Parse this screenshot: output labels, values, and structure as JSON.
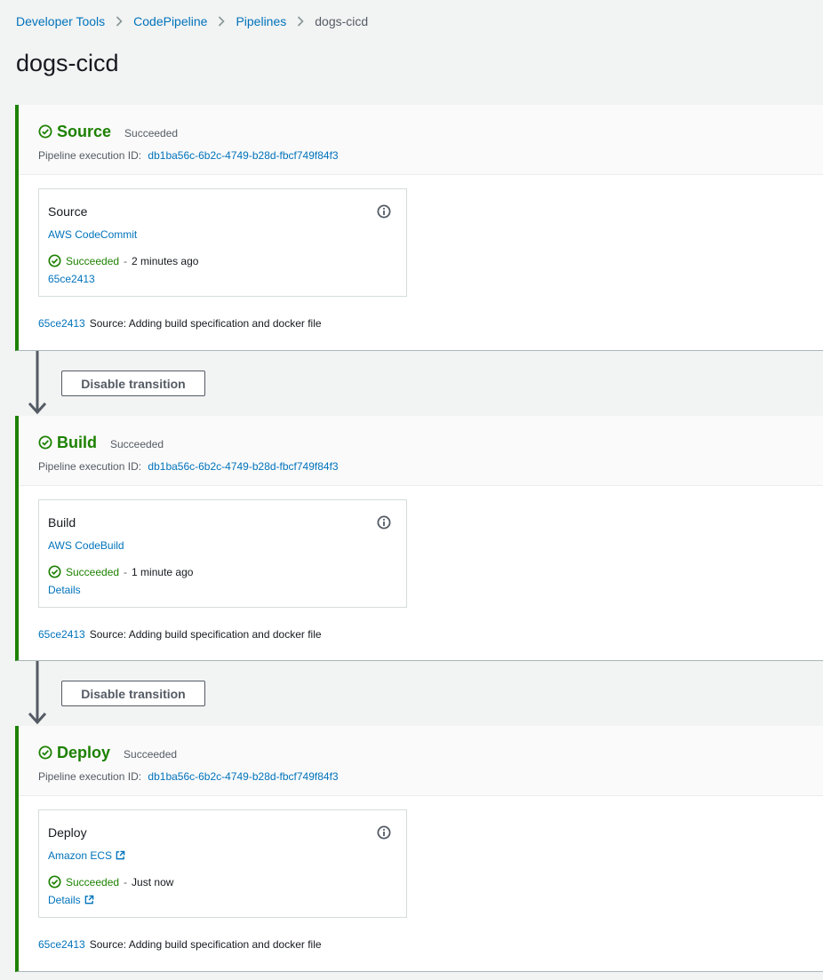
{
  "breadcrumb": {
    "items": [
      "Developer Tools",
      "CodePipeline",
      "Pipelines"
    ],
    "current": "dogs-cicd"
  },
  "page_title": "dogs-cicd",
  "colors": {
    "success": "#1d8102",
    "link": "#0073bb",
    "stage_border": "#1d8102"
  },
  "stages": [
    {
      "name": "Source",
      "status": "Succeeded",
      "exec_label": "Pipeline execution ID:",
      "exec_id": "db1ba56c-6b2c-4749-b28d-fbcf749f84f3",
      "action": {
        "name": "Source",
        "provider": "AWS CodeCommit",
        "status": "Succeeded",
        "dash": "-",
        "time": "2 minutes ago",
        "link": "65ce2413"
      },
      "commit_id": "65ce2413",
      "commit_msg": "Source: Adding build specification and docker file"
    },
    {
      "name": "Build",
      "status": "Succeeded",
      "exec_label": "Pipeline execution ID:",
      "exec_id": "db1ba56c-6b2c-4749-b28d-fbcf749f84f3",
      "action": {
        "name": "Build",
        "provider": "AWS CodeBuild",
        "status": "Succeeded",
        "dash": "-",
        "time": "1 minute ago",
        "link": "Details"
      },
      "commit_id": "65ce2413",
      "commit_msg": "Source: Adding build specification and docker file"
    },
    {
      "name": "Deploy",
      "status": "Succeeded",
      "exec_label": "Pipeline execution ID:",
      "exec_id": "db1ba56c-6b2c-4749-b28d-fbcf749f84f3",
      "action": {
        "name": "Deploy",
        "provider": "Amazon ECS",
        "status": "Succeeded",
        "dash": "-",
        "time": "Just now",
        "link": "Details"
      },
      "commit_id": "65ce2413",
      "commit_msg": "Source: Adding build specification and docker file"
    }
  ],
  "transitions": [
    {
      "button_label": "Disable transition"
    },
    {
      "button_label": "Disable transition"
    }
  ]
}
